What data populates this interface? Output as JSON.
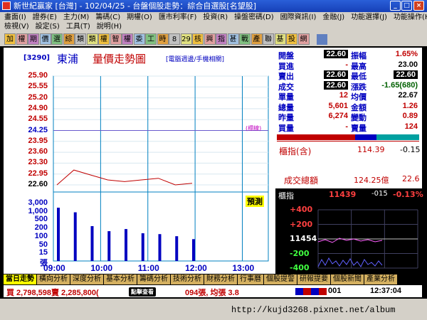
{
  "window": {
    "title": "新世紀贏家 [台灣] - 102/04/25 - 台盤個股走勢：綜合自選股[名望股]",
    "minimize": "_",
    "maximize": "□",
    "close": "×"
  },
  "menu": {
    "row1": [
      "畫面(I)",
      "證券(E)",
      "主力(M)",
      "籌碼(C)",
      "期權(O)",
      "匯市利率(F)",
      "投資(R)",
      "操盤密碼(D)",
      "國際資訊(I)",
      "金融(J)",
      "功能選擇(J)",
      "功能操作(H)"
    ],
    "row2": [
      "檢視(V)",
      "設定(S)",
      "工具(T)",
      "說明(H)"
    ]
  },
  "toolbar": [
    "加",
    "權",
    "期",
    "價",
    "選",
    "綜",
    "類",
    "類",
    "權",
    "智",
    "權",
    "委",
    "工",
    "時",
    "8",
    "29",
    "核",
    "興",
    "指",
    "甚",
    "戰",
    "產",
    "聯",
    "基",
    "投",
    "網"
  ],
  "chart": {
    "stock_id": "[3290]",
    "stock_name": "東浦",
    "title": "量價走勢圖",
    "note": "[電腦週邊/手機相關]",
    "ref_tag": "(標線)",
    "predict_label": "預測",
    "price_levels": [
      "25.90",
      "25.55",
      "25.20",
      "24.90",
      "24.55",
      "24.25",
      "23.95",
      "23.60",
      "23.30",
      "22.95",
      "22.60"
    ],
    "volume_levels": [
      "3,000",
      "1,000",
      "500",
      "200",
      "100",
      "50",
      "15",
      "張"
    ],
    "time_labels": [
      "09:00",
      "10:00",
      "11:00",
      "12:00",
      "13:00"
    ]
  },
  "chart_data": {
    "type": "line",
    "x": [
      "09:00",
      "09:30",
      "10:00",
      "10:30",
      "11:00",
      "11:30",
      "12:00",
      "12:30",
      "13:00"
    ],
    "series": [
      {
        "values": [
          22.6,
          23.05,
          22.9,
          22.75,
          22.7,
          22.75,
          22.8,
          22.6,
          22.65
        ]
      }
    ],
    "ylim": [
      22.6,
      25.9
    ],
    "volume": [
      1500,
      800,
      120,
      60,
      80,
      45,
      40,
      30,
      20
    ]
  },
  "quote": {
    "rows": [
      {
        "l1": "開盤",
        "v1": "22.60",
        "l2": "振幅",
        "v2": "1.65%"
      },
      {
        "l1": "買進",
        "v1": "-",
        "l2": "最高",
        "v2": "23.00"
      },
      {
        "l1": "賣出",
        "v1": "22.60",
        "l2": "最低",
        "v2": "22.60"
      },
      {
        "l1": "成交",
        "v1": "22.60",
        "l2": "漲跌",
        "v2": "-1.65(680)"
      },
      {
        "l1": "單量",
        "v1": "12",
        "l2": "均價",
        "v2": "22.67"
      },
      {
        "l1": "總量",
        "v1": "5,601",
        "l2": "金額",
        "v2": "1.26"
      },
      {
        "l1": "昨量",
        "v1": "6,274",
        "l2": "變動",
        "v2": "0.89"
      },
      {
        "l1": "買量",
        "v1": "-",
        "l2": "賣量",
        "v2": "124"
      }
    ]
  },
  "index_panel": {
    "title": "櫃指(含)",
    "value": "114.39",
    "change": "-0.15",
    "turnover_title": "成交總額",
    "turnover_value": "124.25億",
    "turnover_extra": "22.6"
  },
  "otc": {
    "label": "櫃指",
    "value": "11439",
    "change": "-015",
    "pct": "-0.13%",
    "axis": [
      "+400",
      "+200",
      "11454",
      "-200",
      "-400"
    ]
  },
  "tabs": [
    "當日走勢",
    "橫向分析",
    "深度分析",
    "基本分析",
    "籌碼分析",
    "技術分析",
    "財務分析",
    "行事曆",
    "個股提警",
    "研報提要",
    "個股新聞",
    "產業分析"
  ],
  "status": {
    "left": "買 2,798,598賣 2,285,800(",
    "badge": "點擊查看",
    "mid": "094張, 均張 3.8",
    "code": "001",
    "time": "12:37:04"
  },
  "footer": {
    "url": "http://kujd3268.pixnet.net/album"
  },
  "colors": {
    "price_line": "#c00000",
    "volume_bar": "#0000c0",
    "grid": "#0080c0",
    "ref_line": "#6a5acd"
  }
}
